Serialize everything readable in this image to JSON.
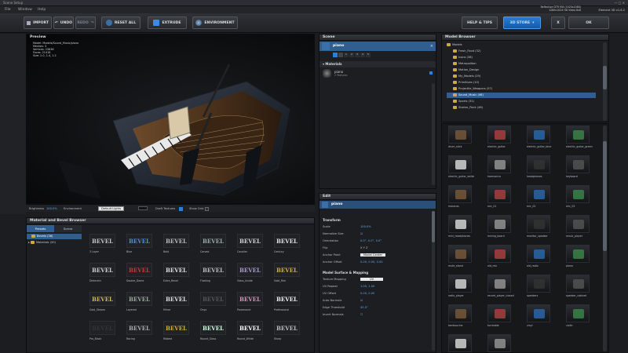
{
  "window": {
    "title": "Scene Setup",
    "controls": "— □ ✕"
  },
  "menu": [
    "File",
    "Window",
    "Help"
  ],
  "render_info": [
    "Reflective DTR Mill (1920x1080)",
    "1280x1024 HD Video 8x6",
    "Element 3D  v1.6.2"
  ],
  "toolbar": {
    "import": "IMPORT",
    "undo": "UNDO",
    "redo": "REDO",
    "reset": "RESET ALL",
    "extrude": "EXTRUDE",
    "environment": "ENVIRONMENT",
    "help": "HELP & TIPS",
    "store": "3D STORE",
    "close": "X",
    "ok": "OK"
  },
  "viewport": {
    "title": "Preview",
    "info": [
      "Model: Models/Sound_Music/piano",
      "Meshes: 3",
      "Vertices: 23636",
      "Faces: 21418",
      "Size: 2.0, 1.4, 1.2"
    ],
    "status": {
      "brightness_label": "Brightness",
      "brightness": "100.0%",
      "environment_label": "Environment",
      "environment": "Default Lights",
      "draft_label": "Draft Textures",
      "grid_label": "Show Grid"
    }
  },
  "scene": {
    "title": "Scene",
    "object": "piano",
    "materials_label": "Materials",
    "material_item": "piano",
    "material_sub": "2 Textures",
    "layer_buttons": [
      "1",
      "2",
      "3",
      "4",
      "5"
    ]
  },
  "edit": {
    "title": "Edit",
    "object": "piano",
    "transform_header": "Transform",
    "transform": [
      {
        "label": "Scale",
        "value": "100.0%"
      },
      {
        "label": "Normalize Size",
        "value": "☑"
      },
      {
        "label": "Orientation",
        "value": "0.0°, 0.0°, 0.0°"
      },
      {
        "label": "Flip",
        "value": "X  Y  Z"
      },
      {
        "label": "Anchor Point",
        "value": "Model Center"
      },
      {
        "label": "Anchor Offset",
        "value": "0.00, 0.00, 0.00"
      }
    ],
    "surface_header": "Model Surface & Mapping",
    "surface": [
      {
        "label": "Texture Mapping",
        "value": "UV"
      },
      {
        "label": "UV Repeat",
        "value": "1.00, 1.00"
      },
      {
        "label": "UV Offset",
        "value": "0.00, 0.00"
      },
      {
        "label": "Auto Normals",
        "value": "☑"
      },
      {
        "label": "Edge Threshold",
        "value": "45.0°"
      },
      {
        "label": "Invert Normals",
        "value": "☐"
      }
    ]
  },
  "model_browser": {
    "title": "Model Browser",
    "tree": [
      {
        "label": "Models",
        "level": 0
      },
      {
        "label": "Fresh_Food (32)",
        "level": 1
      },
      {
        "label": "Icons (38)",
        "level": 1
      },
      {
        "label": "Metropolitan",
        "level": 1
      },
      {
        "label": "Motion_Design",
        "level": 1
      },
      {
        "label": "My_Models (29)",
        "level": 1
      },
      {
        "label": "Primitives (10)",
        "level": 1
      },
      {
        "label": "Projectile_Weapons (57)",
        "level": 1
      },
      {
        "label": "Sound_Music (46)",
        "level": 1,
        "selected": true
      },
      {
        "label": "Sports (31)",
        "level": 1
      },
      {
        "label": "Starter_Pack (46)",
        "level": 1
      }
    ]
  },
  "thumbs": [
    "drum_stick",
    "electric_guitar",
    "electric_guitar_blue",
    "electric_guitar_green",
    "electric_guitar_white",
    "harmonica",
    "headphones",
    "keyboard",
    "maracas",
    "mic_01",
    "mic_02",
    "mic_03",
    "mini_headphones",
    "mixing_board",
    "monitor_speaker",
    "music_player",
    "mute_stand",
    "old_mic",
    "old_radio",
    "piano",
    "radio_player",
    "record_player_closed",
    "speakers",
    "speaker_cabinet",
    "tambourine",
    "turntable",
    "vinyl",
    "violin",
    "violin_bow",
    "xlr_cable"
  ],
  "bevel": {
    "title": "Material and Bevel Browser",
    "tabs": [
      "Presets",
      "Scene"
    ],
    "tree": [
      "Bevels (36)",
      "Materials (20)"
    ],
    "word": "BEVEL",
    "items": [
      "3 Layer",
      "Blue",
      "Bold",
      "Carved",
      "Cavalier",
      "Century",
      "Dielectric",
      "Double_Dome",
      "Extra_Bevel",
      "Floating",
      "Glass_Inside",
      "Gold_Rim",
      "Gold_Stripes",
      "Layered",
      "Mirror",
      "Onyx",
      "Paramount",
      "Professional",
      "Pro_Black",
      "Racing",
      "Ribbed",
      "Round_Glass",
      "Round_White",
      "Sharp"
    ]
  },
  "colors": {
    "accent": "#2f7fd6",
    "selection": "#2f5e8f"
  }
}
